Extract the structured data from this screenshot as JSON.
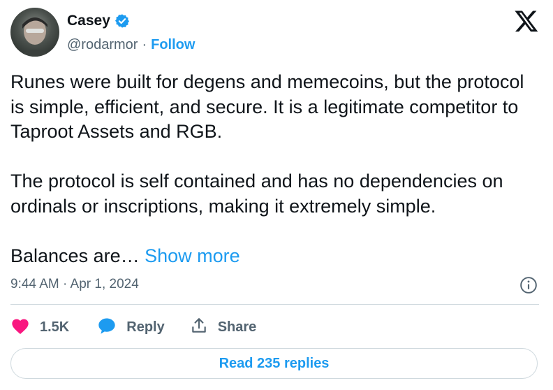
{
  "author": {
    "name": "Casey",
    "handle": "@rodarmor",
    "separator": "·",
    "follow_label": "Follow",
    "verified_icon": "verified-badge-icon",
    "avatar_icon": "avatar"
  },
  "tweet": {
    "paragraph_1": "Runes were built for degens and memecoins, but the protocol is simple, efficient, and secure. It is a legitimate competitor to Taproot Assets and RGB.",
    "paragraph_2": "The protocol is self contained and has no dependencies on ordinals or inscriptions, making it extremely simple.",
    "paragraph_3": "Balances are…",
    "show_more": "Show more",
    "timestamp": "9:44 AM · Apr 1, 2024"
  },
  "actions": {
    "like_count": "1.5K",
    "reply_label": "Reply",
    "share_label": "Share"
  },
  "footer": {
    "read_replies_label": "Read 235 replies"
  },
  "colors": {
    "accent": "#1d9bf0",
    "like": "#f91880",
    "text": "#0f1419",
    "muted": "#536471",
    "border": "#cfd9de"
  },
  "icons": {
    "logo": "x-logo-icon",
    "info": "info-icon",
    "like": "heart-icon",
    "reply": "speech-bubble-icon",
    "share": "share-icon"
  }
}
